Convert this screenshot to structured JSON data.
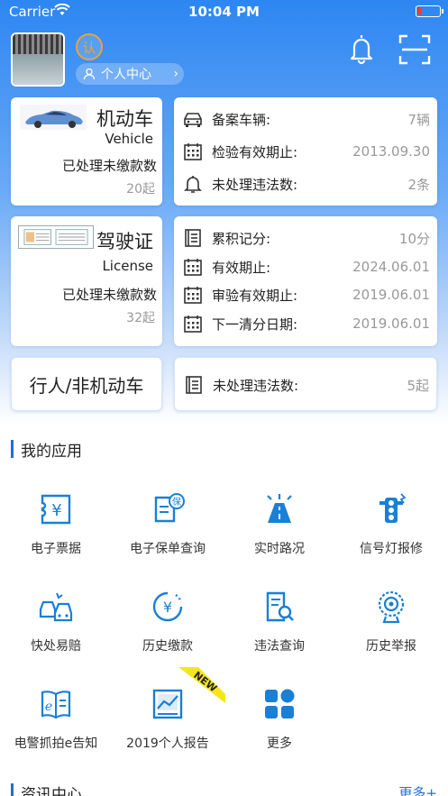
{
  "status_bar": {
    "carrier": "Carrier",
    "time": "10:04 PM"
  },
  "header": {
    "verify_badge": "认",
    "personal_center_label": "个人中心"
  },
  "vehicle_card": {
    "title": "机动车",
    "subtitle": "Vehicle",
    "unpaid_label": "已处理未缴款数",
    "unpaid_count": "20起"
  },
  "vehicle_info": [
    {
      "icon": "car-icon",
      "label": "备案车辆:",
      "value": "7辆"
    },
    {
      "icon": "calendar-icon",
      "label": "检验有效期止:",
      "value": "2013.09.30"
    },
    {
      "icon": "bell-icon",
      "label": "未处理违法数:",
      "value": "2条"
    }
  ],
  "license_card": {
    "title": "驾驶证",
    "subtitle": "License",
    "unpaid_label": "已处理未缴款数",
    "unpaid_count": "32起"
  },
  "license_info": [
    {
      "icon": "list-icon",
      "label": "累积记分:",
      "value": "10分"
    },
    {
      "icon": "calendar-icon",
      "label": "有效期止:",
      "value": "2024.06.01"
    },
    {
      "icon": "calendar-icon",
      "label": "审验有效期止:",
      "value": "2019.06.01"
    },
    {
      "icon": "calendar-icon",
      "label": "下一清分日期:",
      "value": "2019.06.01"
    }
  ],
  "pedestrian_card": {
    "title": "行人/非机动车"
  },
  "pedestrian_info": {
    "icon": "list-icon",
    "label": "未处理违法数:",
    "value": "5起"
  },
  "my_apps": {
    "title": "我的应用",
    "items": [
      {
        "icon": "e-ticket-icon",
        "label": "电子票据"
      },
      {
        "icon": "e-policy-icon",
        "label": "电子保单查询"
      },
      {
        "icon": "road-icon",
        "label": "实时路况"
      },
      {
        "icon": "traffic-light-icon",
        "label": "信号灯报修"
      },
      {
        "icon": "accident-icon",
        "label": "快处易赔"
      },
      {
        "icon": "payment-history-icon",
        "label": "历史缴款"
      },
      {
        "icon": "violation-search-icon",
        "label": "违法查询"
      },
      {
        "icon": "report-camera-icon",
        "label": "历史举报"
      },
      {
        "icon": "e-notice-icon",
        "label": "电警抓拍e告知"
      },
      {
        "icon": "annual-report-icon",
        "label": "2019个人报告"
      },
      {
        "icon": "more-grid-icon",
        "label": "更多"
      }
    ],
    "new_badge": "NEW"
  },
  "news": {
    "title": "资讯中心",
    "more": "更多+"
  },
  "colors": {
    "accent": "#1e6fd9",
    "icon_blue": "#1a7fd6",
    "badge_yellow": "#f5e61a"
  }
}
